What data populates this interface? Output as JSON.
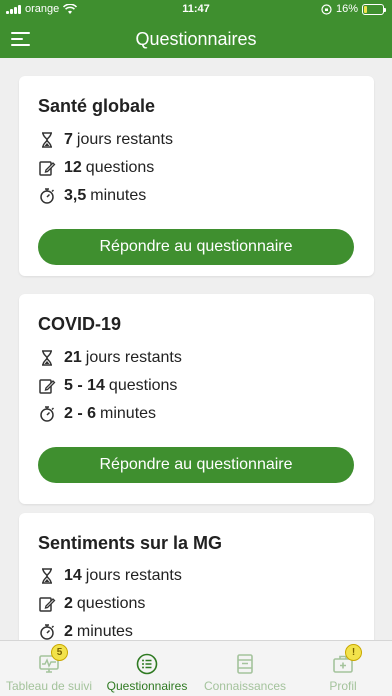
{
  "status_bar": {
    "carrier": "orange",
    "time": "11:47",
    "battery_percent": "16%",
    "battery_level": 0.16,
    "icons": [
      "signal-icon",
      "wifi-icon",
      "orientation-lock-icon",
      "battery-charging-icon"
    ]
  },
  "navbar": {
    "title": "Questionnaires",
    "menu_icon": "hamburger-menu-icon"
  },
  "questionnaires": [
    {
      "title": "Santé globale",
      "days_value": "7",
      "days_label": "jours restants",
      "questions_value": "12",
      "questions_label": "questions",
      "minutes_value": "3,5",
      "minutes_label": "minutes",
      "button_label": "Répondre au questionnaire"
    },
    {
      "title": "COVID-19",
      "days_value": "21",
      "days_label": "jours restants",
      "questions_value": "5 - 14",
      "questions_label": "questions",
      "minutes_value": "2 - 6",
      "minutes_label": "minutes",
      "button_label": "Répondre au questionnaire"
    },
    {
      "title": "Sentiments sur la MG",
      "days_value": "14",
      "days_label": "jours restants",
      "questions_value": "2",
      "questions_label": "questions",
      "minutes_value": "2",
      "minutes_label": "minutes"
    }
  ],
  "tabbar": {
    "tabs": [
      {
        "label": "Tableau de suivi",
        "icon": "monitor-chart-icon",
        "badge": "5",
        "active": false
      },
      {
        "label": "Questionnaires",
        "icon": "list-circle-icon",
        "active": true
      },
      {
        "label": "Connaissances",
        "icon": "book-icon",
        "active": false
      },
      {
        "label": "Profil",
        "icon": "medical-kit-icon",
        "badge": "!",
        "active": false
      }
    ]
  },
  "colors": {
    "brand_green": "#3f8f2f",
    "active_tab": "#2f7a22",
    "inactive_tab": "#a4c39c",
    "badge_yellow": "#f2e24b",
    "background": "#efefef"
  }
}
